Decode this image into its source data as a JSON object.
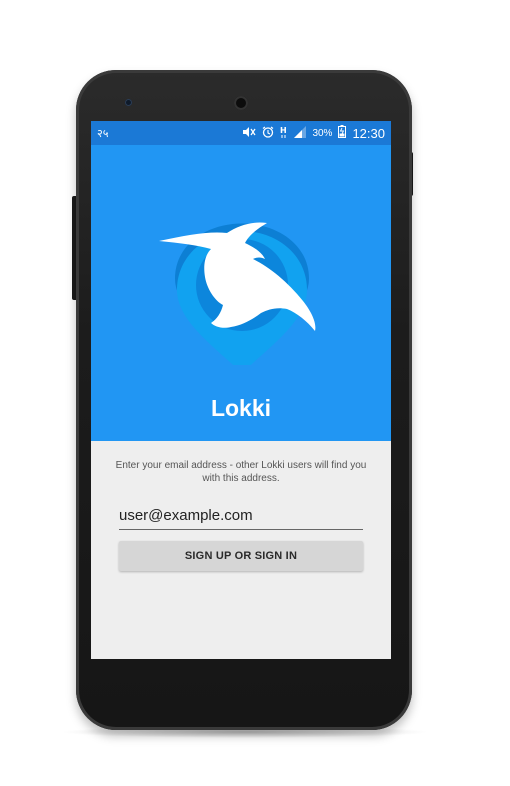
{
  "status_bar": {
    "carrier": "२५",
    "battery_percent": "30%",
    "time": "12:30",
    "icons": [
      "mute-icon",
      "alarm-icon",
      "signal-h-icon",
      "signal-bars-icon",
      "battery-icon"
    ]
  },
  "app": {
    "name": "Lokki",
    "accent_color": "#2196f3",
    "logo": "lokki-bird-pin-logo"
  },
  "login": {
    "hint": "Enter your email address - other Lokki users will find you with this address.",
    "email_value": "user@example.com",
    "signup_button_label": "SIGN UP OR SIGN IN"
  }
}
